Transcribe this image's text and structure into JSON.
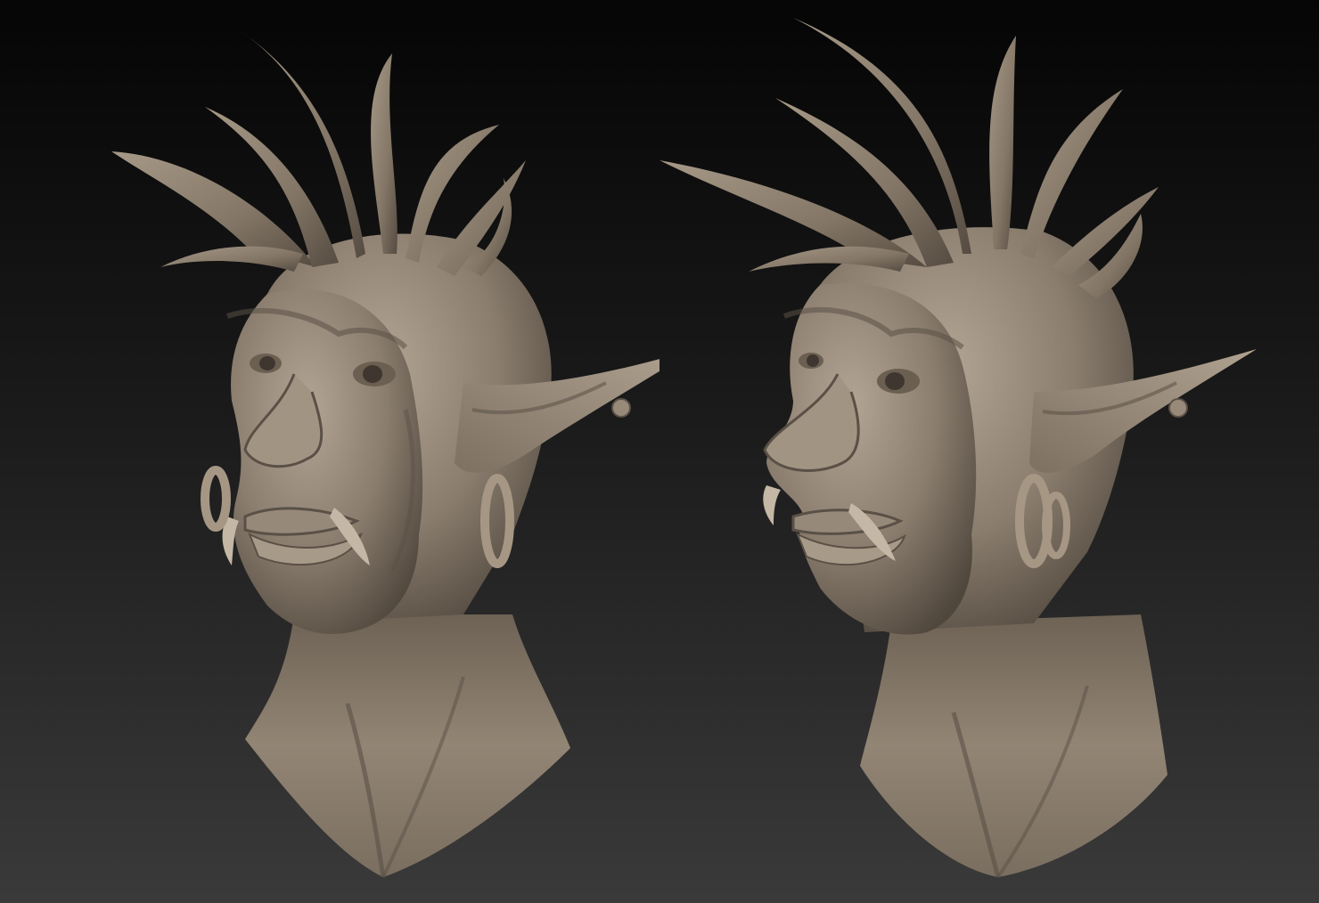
{
  "scene": {
    "background_top": "#050505",
    "background_bottom": "#3a3a3a",
    "clay_color": "#8a7d6e",
    "clay_highlight": "#b3a594",
    "clay_shadow": "#4f463c"
  },
  "busts": [
    {
      "subject": "troll-head-sculpt",
      "view": "three-quarter-front"
    },
    {
      "subject": "troll-head-sculpt",
      "view": "side-profile"
    }
  ]
}
